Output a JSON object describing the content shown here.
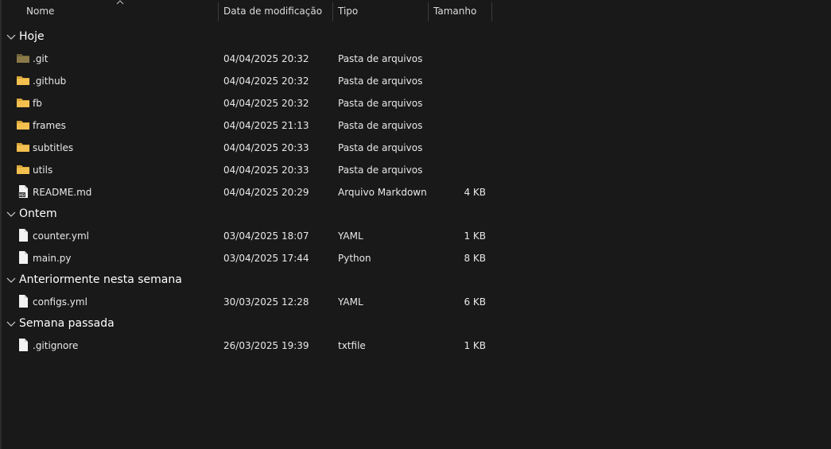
{
  "columns": {
    "name": "Nome",
    "date": "Data de modificação",
    "type": "Tipo",
    "size": "Tamanho"
  },
  "groups": [
    {
      "label": "Hoje",
      "items": [
        {
          "name": ".git",
          "date": "04/04/2025 20:32",
          "type": "Pasta de arquivos",
          "size": "",
          "icon": "folder-dark-icon"
        },
        {
          "name": ".github",
          "date": "04/04/2025 20:32",
          "type": "Pasta de arquivos",
          "size": "",
          "icon": "folder-icon"
        },
        {
          "name": "fb",
          "date": "04/04/2025 20:32",
          "type": "Pasta de arquivos",
          "size": "",
          "icon": "folder-icon"
        },
        {
          "name": "frames",
          "date": "04/04/2025 21:13",
          "type": "Pasta de arquivos",
          "size": "",
          "icon": "folder-icon"
        },
        {
          "name": "subtitles",
          "date": "04/04/2025 20:33",
          "type": "Pasta de arquivos",
          "size": "",
          "icon": "folder-icon"
        },
        {
          "name": "utils",
          "date": "04/04/2025 20:33",
          "type": "Pasta de arquivos",
          "size": "",
          "icon": "folder-icon"
        },
        {
          "name": "README.md",
          "date": "04/04/2025 20:29",
          "type": "Arquivo Markdown",
          "size": "4 KB",
          "icon": "markdown-file-icon"
        }
      ]
    },
    {
      "label": "Ontem",
      "items": [
        {
          "name": "counter.yml",
          "date": "03/04/2025 18:07",
          "type": "YAML",
          "size": "1 KB",
          "icon": "file-icon"
        },
        {
          "name": "main.py",
          "date": "03/04/2025 17:44",
          "type": "Python",
          "size": "8 KB",
          "icon": "file-icon"
        }
      ]
    },
    {
      "label": "Anteriormente nesta semana",
      "items": [
        {
          "name": "configs.yml",
          "date": "30/03/2025 12:28",
          "type": "YAML",
          "size": "6 KB",
          "icon": "file-icon"
        }
      ]
    },
    {
      "label": "Semana passada",
      "items": [
        {
          "name": ".gitignore",
          "date": "26/03/2025 19:39",
          "type": "txtfile",
          "size": "1 KB",
          "icon": "file-icon"
        }
      ]
    }
  ],
  "colors": {
    "background": "#191919",
    "folder": "#f3c04f",
    "folder_dark": "#8a7a4a"
  }
}
